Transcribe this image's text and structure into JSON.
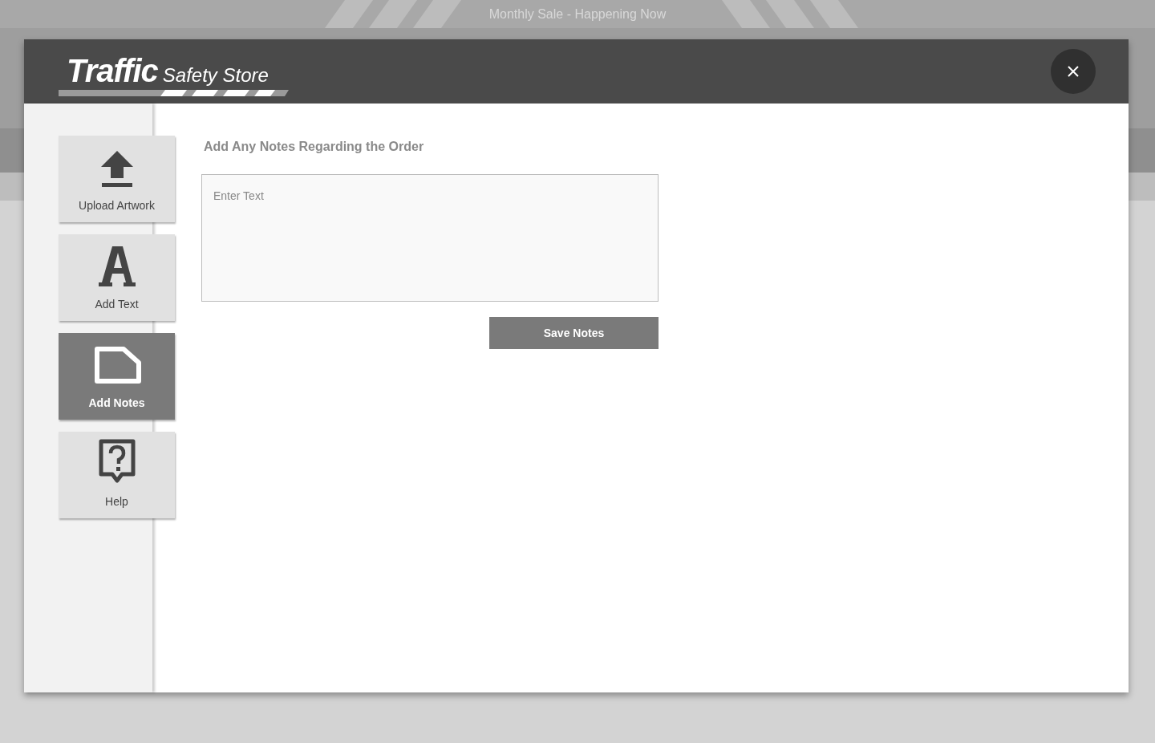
{
  "backdrop": {
    "banner": "Monthly Sale - Happening Now"
  },
  "modal": {
    "logo": {
      "brand": "Traffic",
      "subtitle": "Safety Store"
    },
    "tools": [
      {
        "kind": "upload",
        "label": "Upload Artwork",
        "selected": false
      },
      {
        "kind": "text",
        "label": "Add Text",
        "selected": false
      },
      {
        "kind": "notes",
        "label": "Add Notes",
        "selected": true
      },
      {
        "kind": "help",
        "label": "Help",
        "selected": false
      }
    ],
    "heading": "Add Any Notes Regarding the Order",
    "notes_field": {
      "placeholder": "Enter Text"
    },
    "save_button": "Save Notes"
  }
}
